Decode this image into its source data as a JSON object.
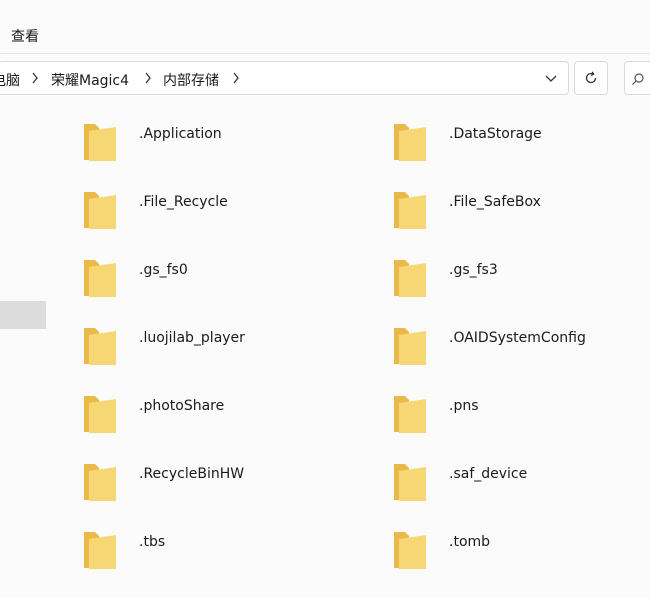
{
  "menu": {
    "view_label": "查看"
  },
  "address": {
    "crumbs": [
      "电脑",
      "荣耀Magic4",
      "内部存储"
    ]
  },
  "folders": {
    "left": [
      ".Application",
      ".File_Recycle",
      ".gs_fs0",
      ".luojilab_player",
      ".photoShare",
      ".RecycleBinHW",
      ".tbs"
    ],
    "right": [
      ".DataStorage",
      ".File_SafeBox",
      ".gs_fs3",
      ".OAIDSystemConfig",
      ".pns",
      ".saf_device",
      ".tomb"
    ]
  },
  "icons": {
    "folder": "folder-icon",
    "separator": "chevron-right-icon",
    "dropdown": "chevron-down-icon",
    "refresh": "refresh-icon",
    "search": "search-icon"
  },
  "colors": {
    "folder_back": "#e9b94a",
    "folder_front": "#f7d774",
    "selection": "#dcdcdc"
  }
}
